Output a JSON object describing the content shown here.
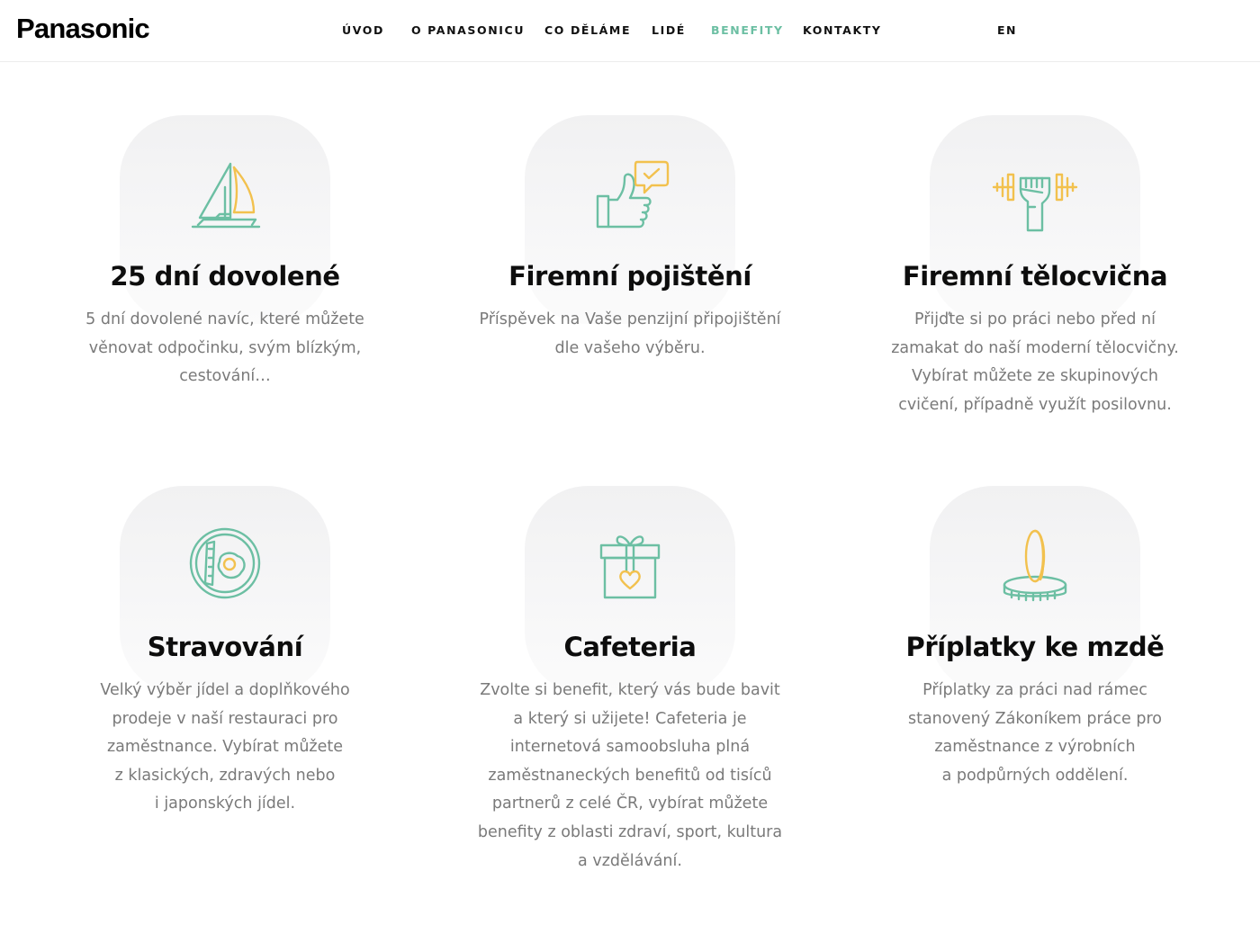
{
  "header": {
    "logo": "Panasonic",
    "nav": [
      {
        "label": "ÚVOD",
        "active": false
      },
      {
        "label": "O PANASONICU",
        "active": false
      },
      {
        "label": "CO DĚLÁME",
        "active": false
      },
      {
        "label": "LIDÉ",
        "active": false
      },
      {
        "label": "BENEFITY",
        "active": true
      },
      {
        "label": "KONTAKTY",
        "active": false
      }
    ],
    "lang": "EN"
  },
  "colors": {
    "accent_green": "#6cbfa3",
    "accent_yellow": "#f2c14e",
    "text_gray": "#7a7a7a"
  },
  "benefits": [
    {
      "icon": "sailboat-icon",
      "title": "25 dní dovolené",
      "lines": [
        "5 dní dovolené navíc, které můžete",
        "věnovat odpočinku, svým blízkým,",
        "cestování…"
      ]
    },
    {
      "icon": "thumbs-up-icon",
      "title": "Firemní pojištění",
      "lines": [
        "Příspěvek na Vaše penzijní připojištění",
        "dle vašeho výběru."
      ]
    },
    {
      "icon": "dumbbell-icon",
      "title": "Firemní tělocvična",
      "lines": [
        "Přijďte si po práci nebo před ní",
        "zamakat do naší moderní tělocvičny.",
        "Vybírat můžete ze skupinových",
        "cvičení, případně využít posilovnu."
      ]
    },
    {
      "icon": "breakfast-plate-icon",
      "title": "Stravování",
      "lines": [
        "Velký výběr jídel a doplňkového",
        "prodeje v naší restauraci pro",
        "zaměstnance. Vybírat můžete",
        "z klasických, zdravých nebo",
        "i japonských jídel."
      ]
    },
    {
      "icon": "gift-box-icon",
      "title": "Cafeteria",
      "lines": [
        "Zvolte si benefit, který vás bude bavit",
        "a který si užijete! Cafeteria je",
        "internetová samoobsluha plná",
        "zaměstnaneckých benefitů od tisíců",
        "partnerů z celé ČR, vybírat můžete",
        "benefity z oblasti zdraví, sport, kultura",
        "a vzdělávání."
      ]
    },
    {
      "icon": "coin-stack-icon",
      "title": "Příplatky ke mzdě",
      "lines": [
        "Příplatky za práci nad rámec",
        "stanovený Zákoníkem práce pro",
        "zaměstnance z výrobních",
        "a podpůrných oddělení."
      ]
    }
  ]
}
